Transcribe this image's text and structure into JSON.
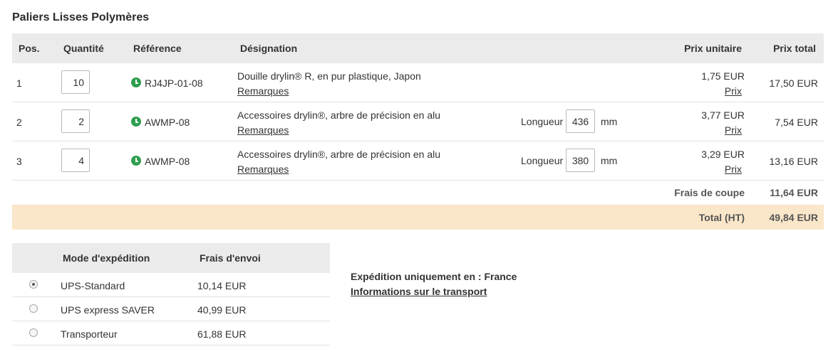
{
  "title": "Paliers Lisses Polymères",
  "order": {
    "headers": {
      "pos": "Pos.",
      "quantity": "Quantité",
      "reference": "Référence",
      "designation": "Désignation",
      "unit_price": "Prix unitaire",
      "total_price": "Prix total"
    },
    "rows": [
      {
        "pos": "1",
        "quantity": "10",
        "reference": "RJ4JP-01-08",
        "designation": "Douille drylin® R, en pur plastique, Japon",
        "remarks": "Remarques",
        "length_label": "",
        "length": "",
        "length_unit": "",
        "unit_price": "1,75 EUR",
        "price_link": "Prix",
        "total": "17,50 EUR"
      },
      {
        "pos": "2",
        "quantity": "2",
        "reference": "AWMP-08",
        "designation": "Accessoires drylin®, arbre de précision en alu",
        "remarks": "Remarques",
        "length_label": "Longueur",
        "length": "436",
        "length_unit": "mm",
        "unit_price": "3,77 EUR",
        "price_link": "Prix",
        "total": "7,54 EUR"
      },
      {
        "pos": "3",
        "quantity": "4",
        "reference": "AWMP-08",
        "designation": "Accessoires drylin®, arbre de précision en alu",
        "remarks": "Remarques",
        "length_label": "Longueur",
        "length": "380",
        "length_unit": "mm",
        "unit_price": "3,29 EUR",
        "price_link": "Prix",
        "total": "13,16 EUR"
      }
    ],
    "cut_fee_label": "Frais de coupe",
    "cut_fee_value": "11,64 EUR",
    "total_label": "Total (HT)",
    "total_value": "49,84 EUR"
  },
  "shipping": {
    "headers": {
      "mode": "Mode d'expédition",
      "cost": "Frais d'envoi"
    },
    "options": [
      {
        "name": "UPS-Standard",
        "cost": "10,14 EUR",
        "selected": true
      },
      {
        "name": "UPS express SAVER",
        "cost": "40,99 EUR",
        "selected": false
      },
      {
        "name": "Transporteur",
        "cost": "61,88 EUR",
        "selected": false
      }
    ],
    "info": "Expédition uniquement en : France",
    "info_link": "Informations sur le transport"
  },
  "colors": {
    "status_green": "#2e9e4f",
    "total_row_bg": "#fae6c9",
    "header_bg": "#ebebeb"
  },
  "icons": {
    "availability": "clock-icon"
  }
}
